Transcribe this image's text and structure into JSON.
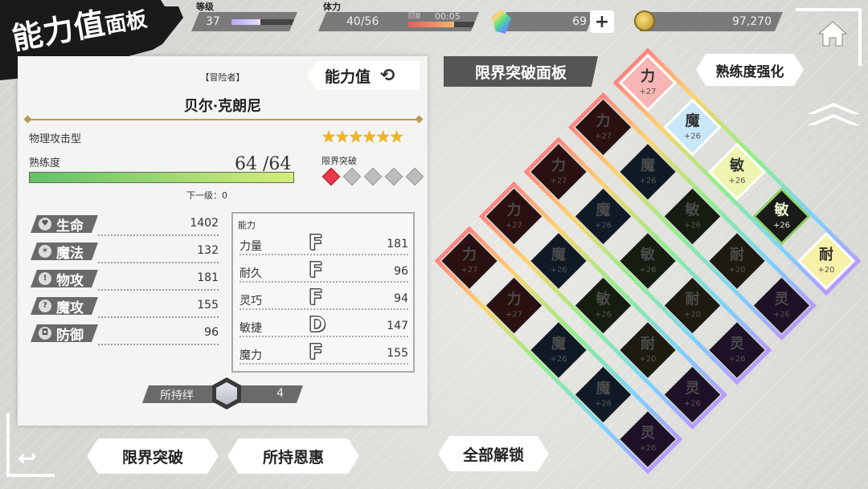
{
  "title": {
    "main": "能力值",
    "sub": "面板"
  },
  "header": {
    "level": {
      "label": "等级",
      "value": "37",
      "progress": 0.45
    },
    "stamina": {
      "label": "体力",
      "value": "40/56",
      "sub_label": "回复",
      "timer": "00:05",
      "progress": 0.7
    },
    "crystals": {
      "value": "69",
      "icon": "crystal-icon",
      "plus": "+"
    },
    "coins": {
      "value": "97,270",
      "icon": "coin-icon"
    }
  },
  "character": {
    "role": "【冒险者】",
    "name": "贝尔·克朗尼",
    "type": "物理攻击型",
    "stars": "★★★★★★",
    "star_count": 6,
    "tab_label": "能力值",
    "proficiency": {
      "label": "熟练度",
      "current": "64",
      "max": "/64",
      "progress": 1.0,
      "next_label": "下一级：0"
    },
    "limit_break": {
      "label": "限界突破",
      "level": 1,
      "max": 5
    }
  },
  "base_stats": [
    {
      "label": "生命",
      "value": "1402",
      "icon": "heart-icon"
    },
    {
      "label": "魔法",
      "value": "132",
      "icon": "magic-icon"
    },
    {
      "label": "物攻",
      "value": "181",
      "icon": "sword-icon"
    },
    {
      "label": "魔攻",
      "value": "155",
      "icon": "staff-icon"
    },
    {
      "label": "防御",
      "value": "96",
      "icon": "shield-icon"
    }
  ],
  "abilities": {
    "title": "能力",
    "rows": [
      {
        "name": "力量",
        "rank": "F",
        "value": "181"
      },
      {
        "name": "耐久",
        "rank": "F",
        "value": "96"
      },
      {
        "name": "灵巧",
        "rank": "F",
        "value": "94"
      },
      {
        "name": "敏捷",
        "rank": "D",
        "value": "147"
      },
      {
        "name": "魔力",
        "rank": "F",
        "value": "155"
      }
    ]
  },
  "bond": {
    "label": "所持绊",
    "value": "4"
  },
  "buttons": {
    "limit_break": "限界突破",
    "blessings": "所持恩惠",
    "unlock_all": "全部解锁",
    "mastery": "熟练度强化"
  },
  "limit_panel": {
    "title": "限界突破面板"
  },
  "grid": {
    "rows": [
      [
        {
          "k": "力",
          "v": "+27",
          "state": "unlocked",
          "color": "#f7b5b5"
        },
        {
          "k": "魔",
          "v": "+26",
          "state": "unlocked",
          "color": "#c8e7f7"
        },
        {
          "k": "敏",
          "v": "+26",
          "state": "unlocked",
          "color": "#eef5b0"
        },
        {
          "k": "敏",
          "v": "+26",
          "state": "available",
          "color": "#1a1a1a"
        },
        {
          "k": "耐",
          "v": "+20",
          "state": "unlocked",
          "color": "#f7f0a8"
        }
      ],
      [
        {
          "k": "力",
          "v": "+27",
          "state": "locked",
          "color": "#2a1010"
        },
        {
          "k": "魔",
          "v": "+26",
          "state": "locked",
          "color": "#0f1a26"
        },
        {
          "k": "敏",
          "v": "+26",
          "state": "locked",
          "color": "#141d10"
        },
        {
          "k": "耐",
          "v": "+20",
          "state": "locked",
          "color": "#1d1a0f"
        },
        {
          "k": "灵",
          "v": "+26",
          "state": "locked",
          "color": "#1e1026"
        }
      ],
      [
        {
          "k": "力",
          "v": "+27",
          "state": "locked",
          "color": "#2a1010"
        },
        {
          "k": "魔",
          "v": "+26",
          "state": "locked",
          "color": "#0f1a26"
        },
        {
          "k": "敏",
          "v": "+26",
          "state": "locked",
          "color": "#141d10"
        },
        {
          "k": "耐",
          "v": "+20",
          "state": "locked",
          "color": "#1d1a0f"
        },
        {
          "k": "灵",
          "v": "+26",
          "state": "locked",
          "color": "#1e1026"
        }
      ],
      [
        {
          "k": "力",
          "v": "+27",
          "state": "locked",
          "color": "#2a1010"
        },
        {
          "k": "魔",
          "v": "+26",
          "state": "locked",
          "color": "#0f1a26"
        },
        {
          "k": "敏",
          "v": "+26",
          "state": "locked",
          "color": "#141d10"
        },
        {
          "k": "耐",
          "v": "+20",
          "state": "locked",
          "color": "#1d1a0f"
        },
        {
          "k": "灵",
          "v": "+26",
          "state": "locked",
          "color": "#1e1026"
        }
      ],
      [
        {
          "k": "力",
          "v": "+27",
          "state": "locked",
          "color": "#2a1010"
        },
        {
          "k": "力",
          "v": "+27",
          "state": "locked",
          "color": "#2a1010"
        },
        {
          "k": "魔",
          "v": "+26",
          "state": "locked",
          "color": "#0f1a26"
        },
        {
          "k": "魔",
          "v": "+26",
          "state": "locked",
          "color": "#0f1a26"
        },
        {
          "k": "灵",
          "v": "+26",
          "state": "locked",
          "color": "#1e1026"
        }
      ]
    ]
  },
  "colors": {
    "dark": "#1a1a1a",
    "accent_gold": "#b99b55",
    "star": "#f3b416",
    "lb_on": "#e83a4a"
  }
}
